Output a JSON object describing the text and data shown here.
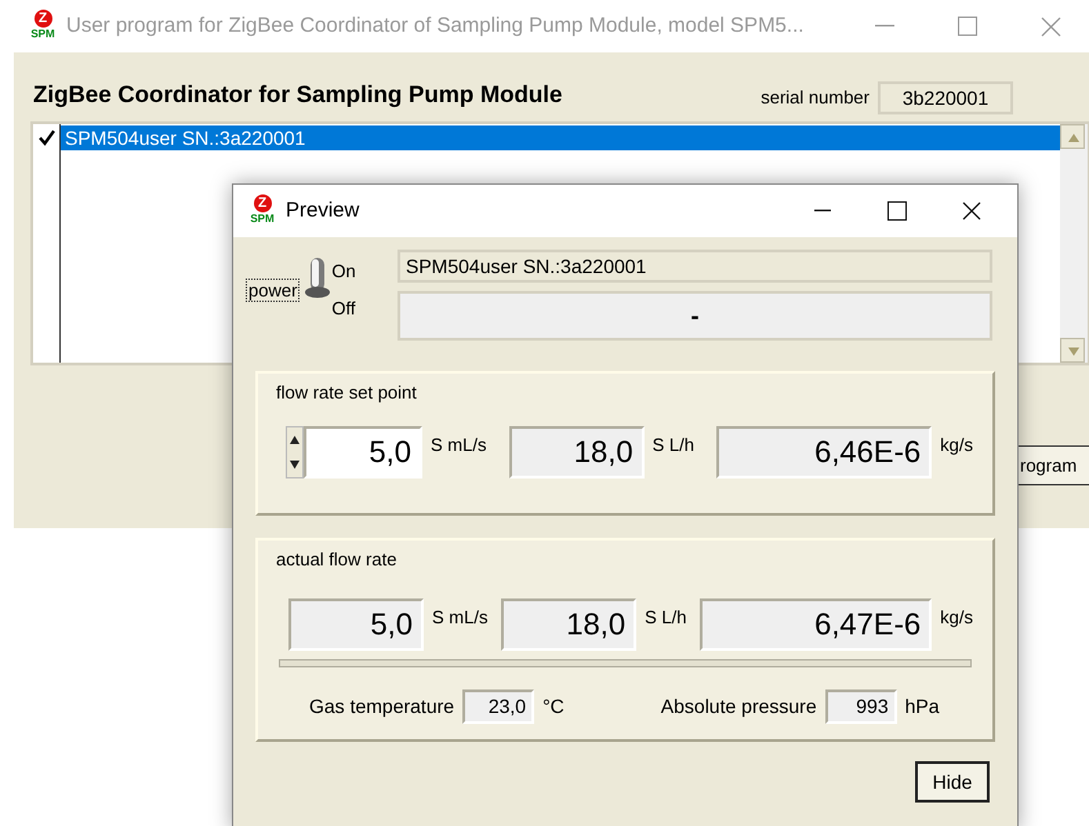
{
  "main_window": {
    "logo": {
      "mark": "Z",
      "caption": "SPM"
    },
    "title": "User program for ZigBee Coordinator of Sampling Pump Module, model SPM5...",
    "heading": "ZigBee Coordinator for Sampling Pump Module",
    "serial_label": "serial number",
    "serial_value": "3b220001",
    "devices": [
      {
        "label": "SPM504user SN.:3a220001",
        "checked": true,
        "selected": true
      }
    ],
    "partial_button": "rogram"
  },
  "preview": {
    "logo": {
      "mark": "Z",
      "caption": "SPM"
    },
    "title": "Preview",
    "power": {
      "label": "power",
      "on_label": "On",
      "off_label": "Off",
      "on": true
    },
    "device_name": "SPM504user SN.:3a220001",
    "status": "-",
    "groups": [
      {
        "title": "flow rate set point",
        "fields": [
          {
            "kind": "spin",
            "value": "5,0",
            "unit": "S mL/s"
          },
          {
            "kind": "readout",
            "value": "18,0",
            "unit": "S L/h"
          },
          {
            "kind": "readout",
            "value": "6,46E-6",
            "unit": "kg/s"
          }
        ]
      },
      {
        "title": "actual flow rate",
        "fields": [
          {
            "kind": "readout",
            "value": "5,0",
            "unit": "S mL/s"
          },
          {
            "kind": "readout",
            "value": "18,0",
            "unit": "S L/h"
          },
          {
            "kind": "readout",
            "value": "6,47E-6",
            "unit": "kg/s"
          }
        ],
        "extras": [
          {
            "label": "Gas temperature",
            "value": "23,0",
            "unit": "°C"
          },
          {
            "label": "Absolute pressure",
            "value": "993",
            "unit": "hPa"
          }
        ]
      }
    ],
    "hide_button": "Hide"
  }
}
